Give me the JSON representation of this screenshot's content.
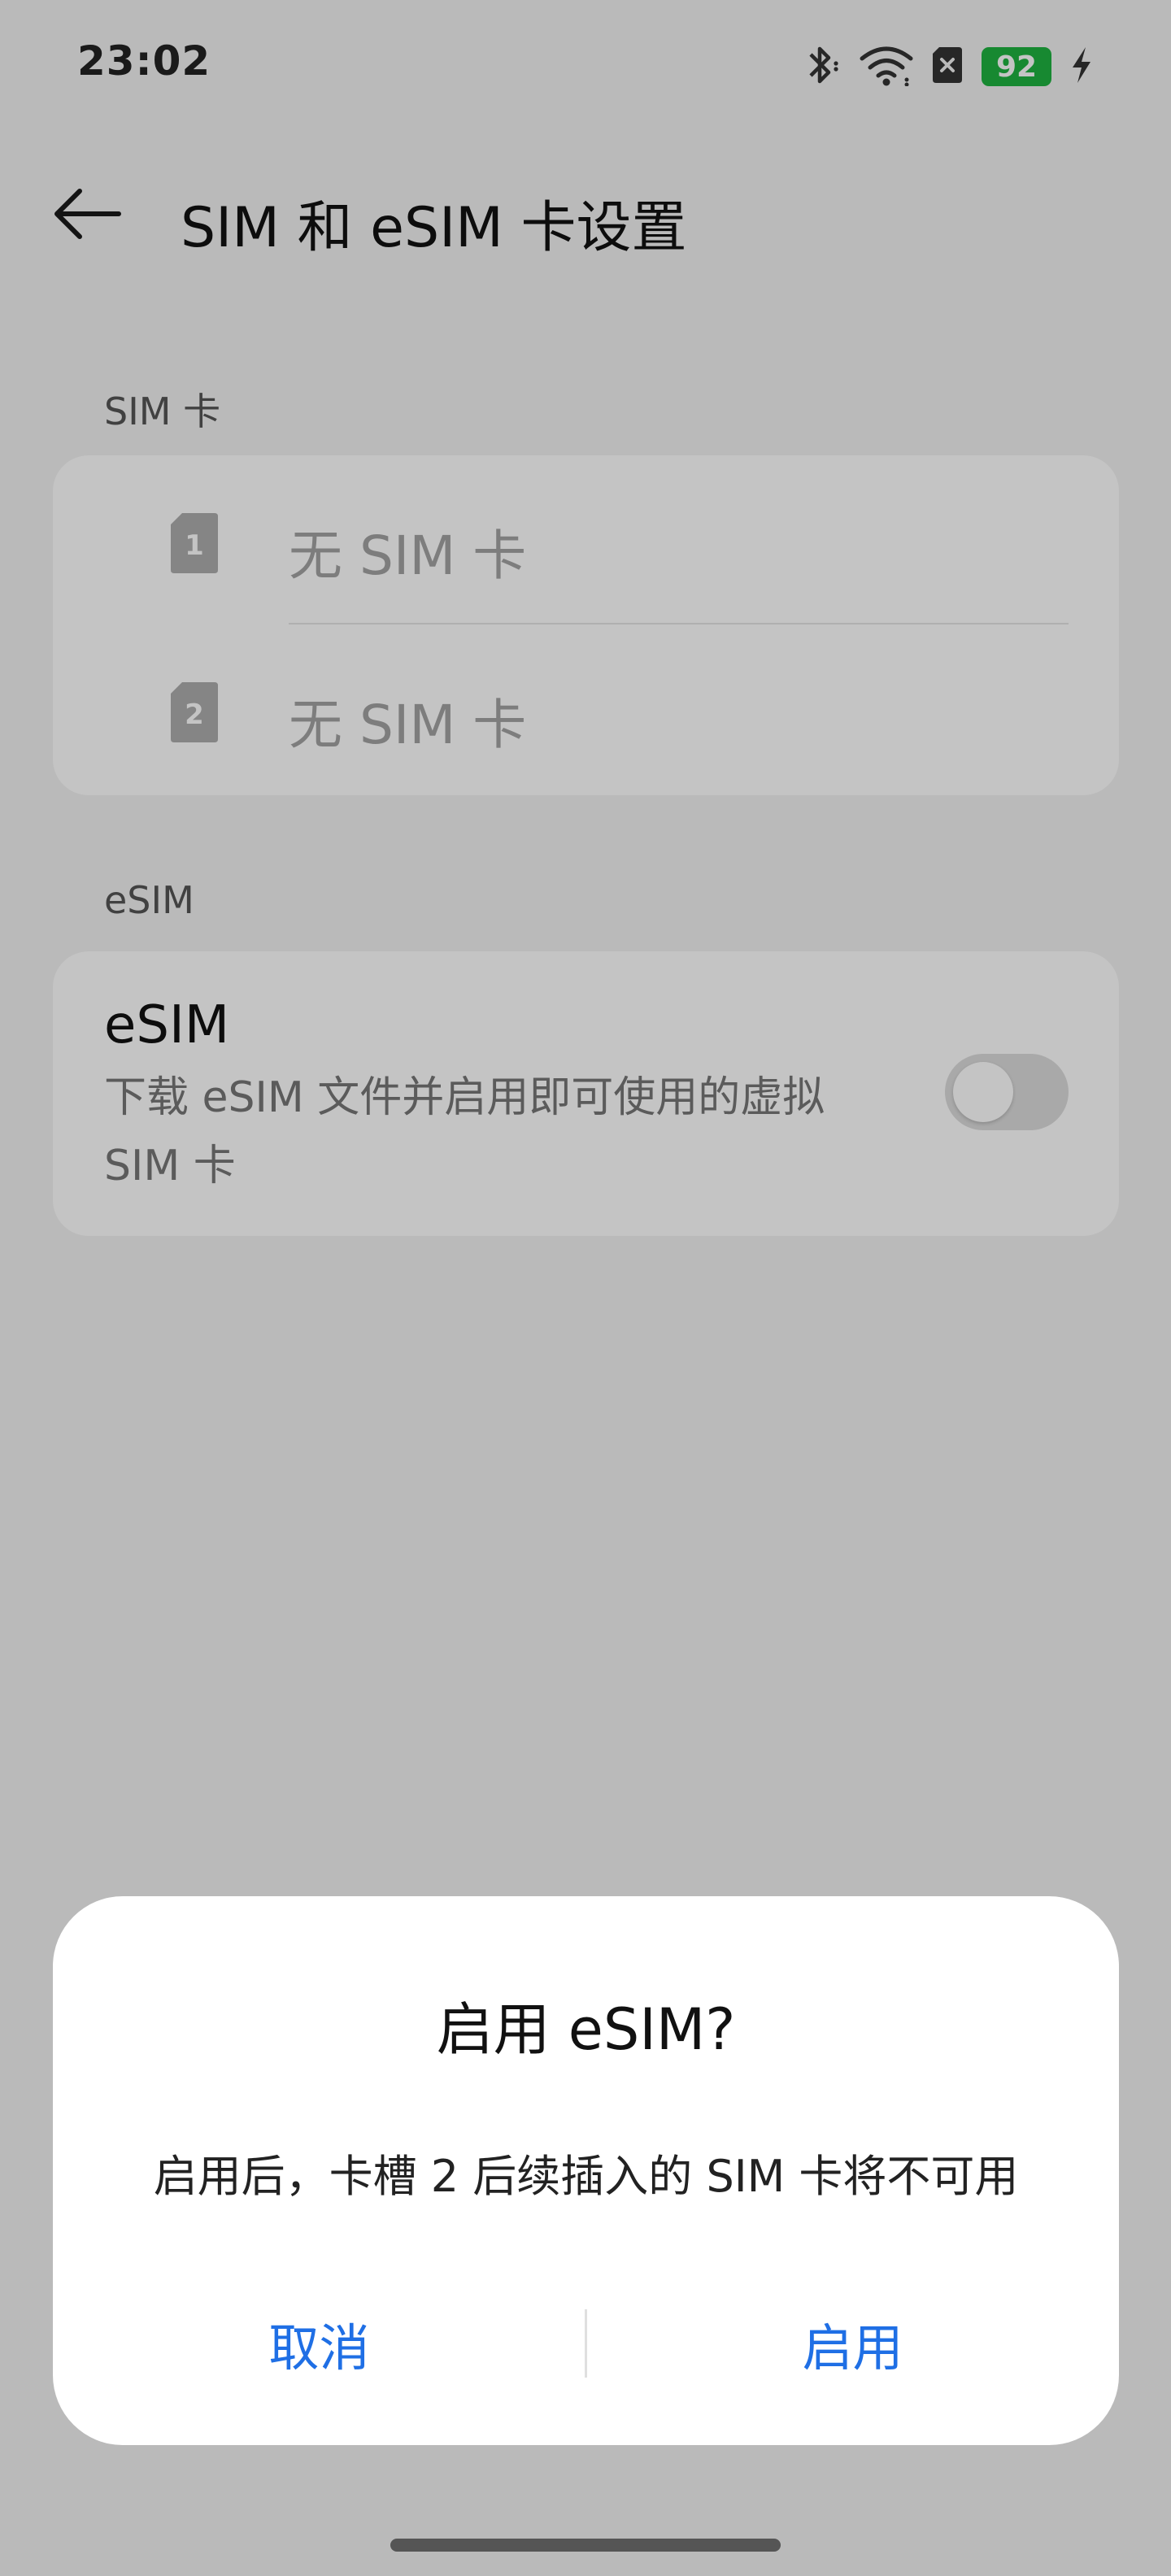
{
  "status_bar": {
    "time": "23:02",
    "battery": "92",
    "icons": [
      "bluetooth-icon",
      "wifi-icon",
      "no-sim-icon",
      "battery-icon",
      "charging-icon"
    ]
  },
  "app_bar": {
    "title": "SIM 和 eSIM 卡设置",
    "back_icon": "back-arrow-icon"
  },
  "sim_section": {
    "header": "SIM 卡",
    "items": [
      {
        "slot": "1",
        "label": "无 SIM 卡"
      },
      {
        "slot": "2",
        "label": "无 SIM 卡"
      }
    ]
  },
  "esim_section": {
    "header": "eSIM",
    "title": "eSIM",
    "description": "下载 eSIM 文件并启用即可使用的虚拟 SIM 卡",
    "toggle_on": false
  },
  "dialog": {
    "title": "启用 eSIM?",
    "message": "启用后，卡槽 2 后续插入的 SIM 卡将不可用",
    "cancel_label": "取消",
    "confirm_label": "启用"
  },
  "colors": {
    "accent": "#1f6fe5",
    "battery": "#1fb340",
    "scrim": "rgba(0,0,0,0.23)"
  }
}
